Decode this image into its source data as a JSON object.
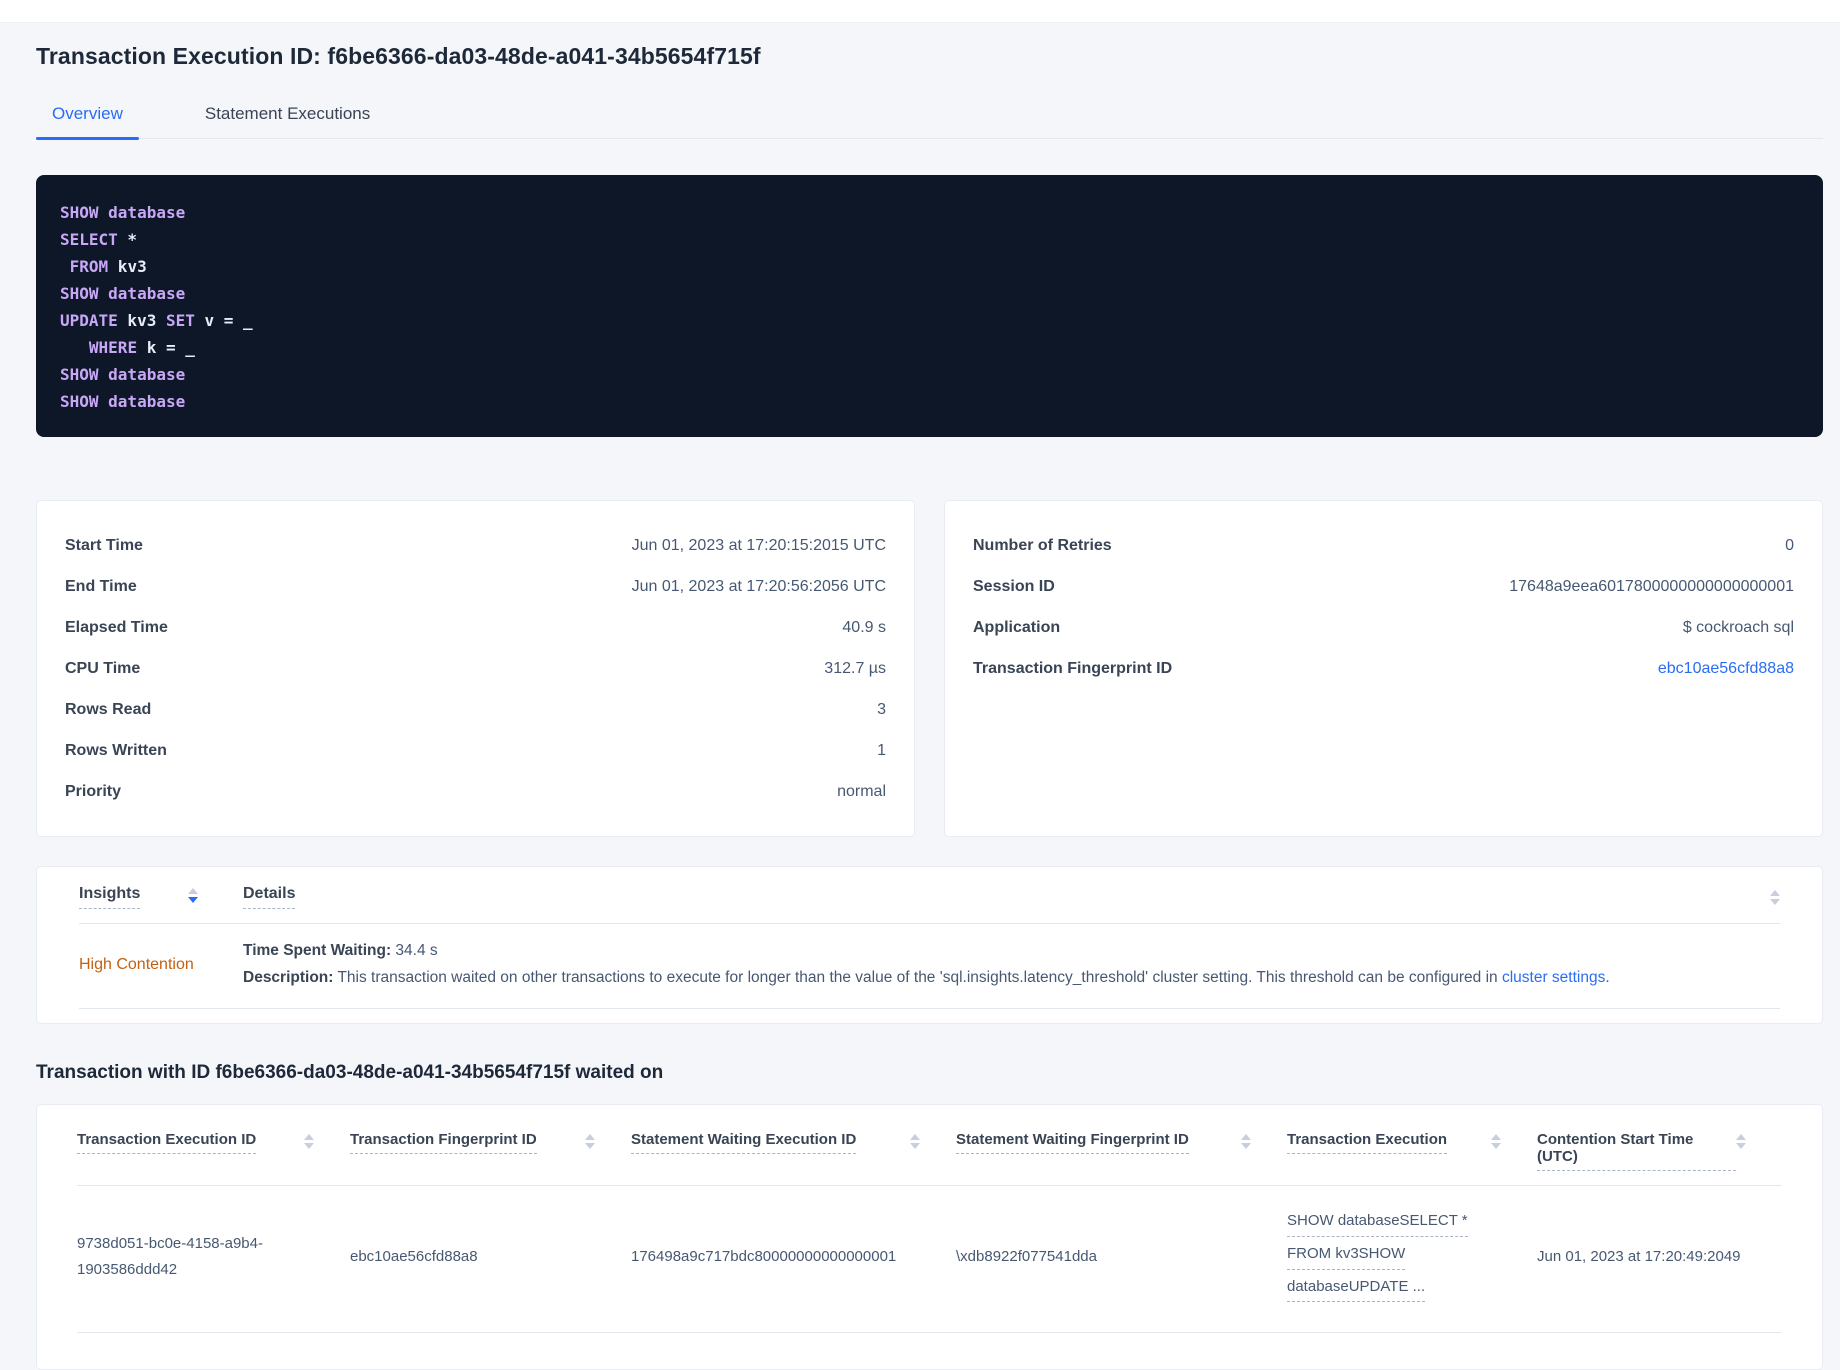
{
  "page": {
    "title": "Transaction Execution ID: f6be6366-da03-48de-a041-34b5654f715f"
  },
  "tabs": [
    {
      "label": "Overview",
      "active": true
    },
    {
      "label": "Statement Executions",
      "active": false
    }
  ],
  "sql": {
    "lines": [
      [
        {
          "text": "SHOW database",
          "kw": true
        }
      ],
      [
        {
          "text": "SELECT",
          "kw": true
        },
        {
          "text": " *",
          "kw": false
        }
      ],
      [
        {
          "text": " ",
          "kw": false
        },
        {
          "text": "FROM",
          "kw": true
        },
        {
          "text": " kv3",
          "kw": false
        }
      ],
      [
        {
          "text": "SHOW database",
          "kw": true
        }
      ],
      [
        {
          "text": "UPDATE",
          "kw": true
        },
        {
          "text": " kv3 ",
          "kw": false
        },
        {
          "text": "SET",
          "kw": true
        },
        {
          "text": " v = _",
          "kw": false
        }
      ],
      [
        {
          "text": "   ",
          "kw": false
        },
        {
          "text": "WHERE",
          "kw": true
        },
        {
          "text": " k = _",
          "kw": false
        }
      ],
      [
        {
          "text": "SHOW database",
          "kw": true
        }
      ],
      [
        {
          "text": "SHOW database",
          "kw": true
        }
      ]
    ]
  },
  "stats_left": {
    "rows": [
      {
        "label": "Start Time",
        "value": "Jun 01, 2023 at 17:20:15:2015 UTC"
      },
      {
        "label": "End Time",
        "value": "Jun 01, 2023 at 17:20:56:2056 UTC"
      },
      {
        "label": "Elapsed Time",
        "value": "40.9 s"
      },
      {
        "label": "CPU Time",
        "value": "312.7 µs"
      },
      {
        "label": "Rows Read",
        "value": "3"
      },
      {
        "label": "Rows Written",
        "value": "1"
      },
      {
        "label": "Priority",
        "value": "normal"
      }
    ]
  },
  "stats_right": {
    "rows": [
      {
        "label": "Number of Retries",
        "value": "0"
      },
      {
        "label": "Session ID",
        "value": "17648a9eea6017800000000000000001"
      },
      {
        "label": "Application",
        "value": "$ cockroach sql"
      },
      {
        "label": "Transaction Fingerprint ID",
        "value": "ebc10ae56cfd88a8",
        "link": true
      }
    ]
  },
  "insights": {
    "header": {
      "insights_label": "Insights",
      "details_label": "Details"
    },
    "row": {
      "insight": "High Contention",
      "waiting_label": "Time Spent Waiting:",
      "waiting_value": " 34.4 s",
      "desc_label": "Description:",
      "desc_text": " This transaction waited on other transactions to execute for longer than the value of the 'sql.insights.latency_threshold' cluster setting. This threshold can be configured in ",
      "desc_link": "cluster settings",
      "desc_period": "."
    }
  },
  "waited_on": {
    "heading": "Transaction with ID f6be6366-da03-48de-a041-34b5654f715f waited on",
    "columns": [
      "Transaction Execution ID",
      "Transaction Fingerprint ID",
      "Statement Waiting Execution ID",
      "Statement Waiting Fingerprint ID",
      "Transaction Execution",
      "Contention Start Time (UTC)"
    ],
    "row": {
      "txn_exec_id": "9738d051-bc0e-4158-a9b4-1903586ddd42",
      "txn_fingerprint_id": "ebc10ae56cfd88a8",
      "stmt_waiting_exec_id": "176498a9c717bdc80000000000000001",
      "stmt_waiting_fingerprint_id": "\\xdb8922f077541dda",
      "txn_execution_lines": [
        "SHOW databaseSELECT *",
        "FROM kv3SHOW",
        "databaseUPDATE ..."
      ],
      "contention_start": "Jun 01, 2023 at 17:20:49:2049"
    }
  },
  "icons": {
    "sort": "sort-arrows"
  },
  "colors": {
    "accent_blue": "#2a6df4",
    "insight_orange": "#c26112",
    "code_background": "#0e1728",
    "code_keyword": "#c8a7f7",
    "code_text": "#e8ecf7",
    "page_background": "#f4f6fa"
  }
}
